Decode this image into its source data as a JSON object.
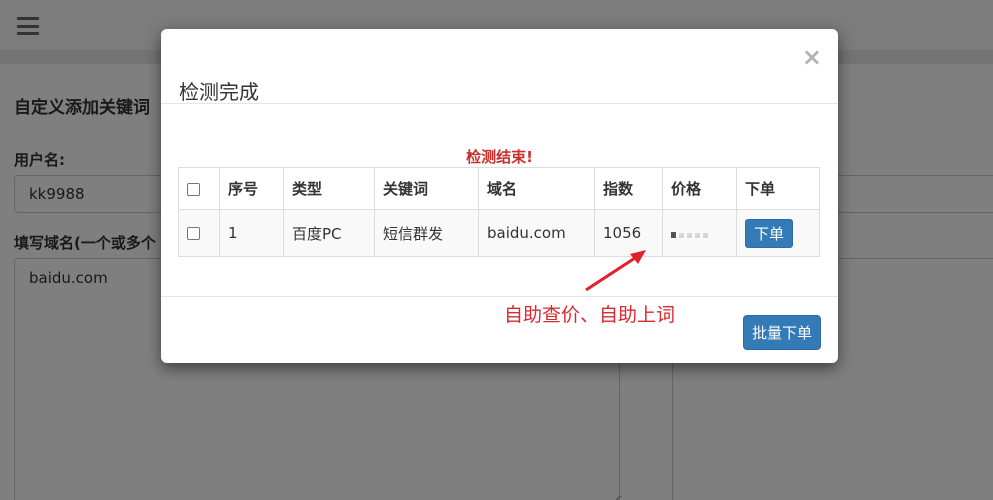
{
  "background": {
    "section_title": "自定义添加关键词",
    "user_label": "用户名:",
    "user_value": "kk9988",
    "domain_label": "填写域名(一个或多个",
    "domain_value": "baidu.com"
  },
  "modal": {
    "title": "检测完成",
    "close_symbol": "×",
    "notice": "检测结束!",
    "table": {
      "headers": [
        "",
        "序号",
        "类型",
        "关键词",
        "域名",
        "指数",
        "价格",
        "下单"
      ],
      "rows": [
        {
          "index": "1",
          "type": "百度PC",
          "keyword": "短信群发",
          "domain": "baidu.com",
          "score": "1056",
          "order_label": "下单"
        }
      ]
    },
    "batch_order_label": "批量下单"
  },
  "annotation": {
    "text": "自助查价、自助上词",
    "color": "#d9282f"
  },
  "colors": {
    "primary": "#337ab7",
    "notice": "#c9302c"
  }
}
